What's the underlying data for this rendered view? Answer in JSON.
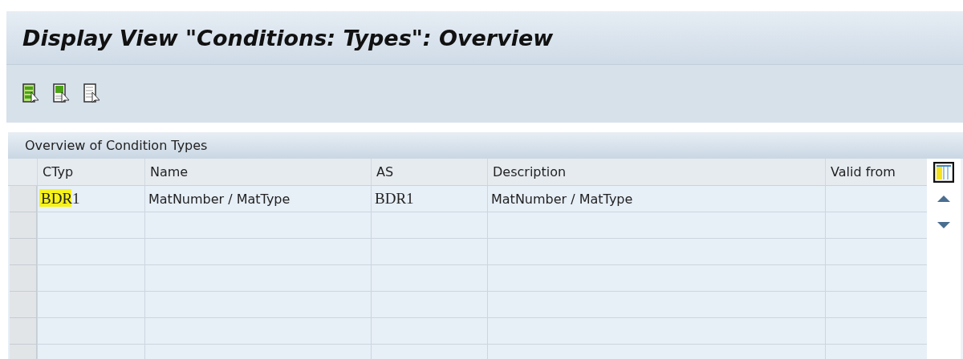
{
  "window": {
    "title": "Display View \"Conditions: Types\": Overview"
  },
  "toolbar": {
    "buttons": [
      {
        "kind": "full"
      },
      {
        "kind": "partial"
      },
      {
        "kind": "plain"
      }
    ]
  },
  "table": {
    "title": "Overview of Condition Types",
    "columns": [
      "CTyp",
      "Name",
      "AS",
      "Description",
      "Valid from"
    ],
    "rows": [
      {
        "cells": [
          "BDR1",
          "MatNumber / MatType",
          "BDR1",
          "MatNumber / MatType",
          ""
        ],
        "marked": true
      }
    ]
  }
}
